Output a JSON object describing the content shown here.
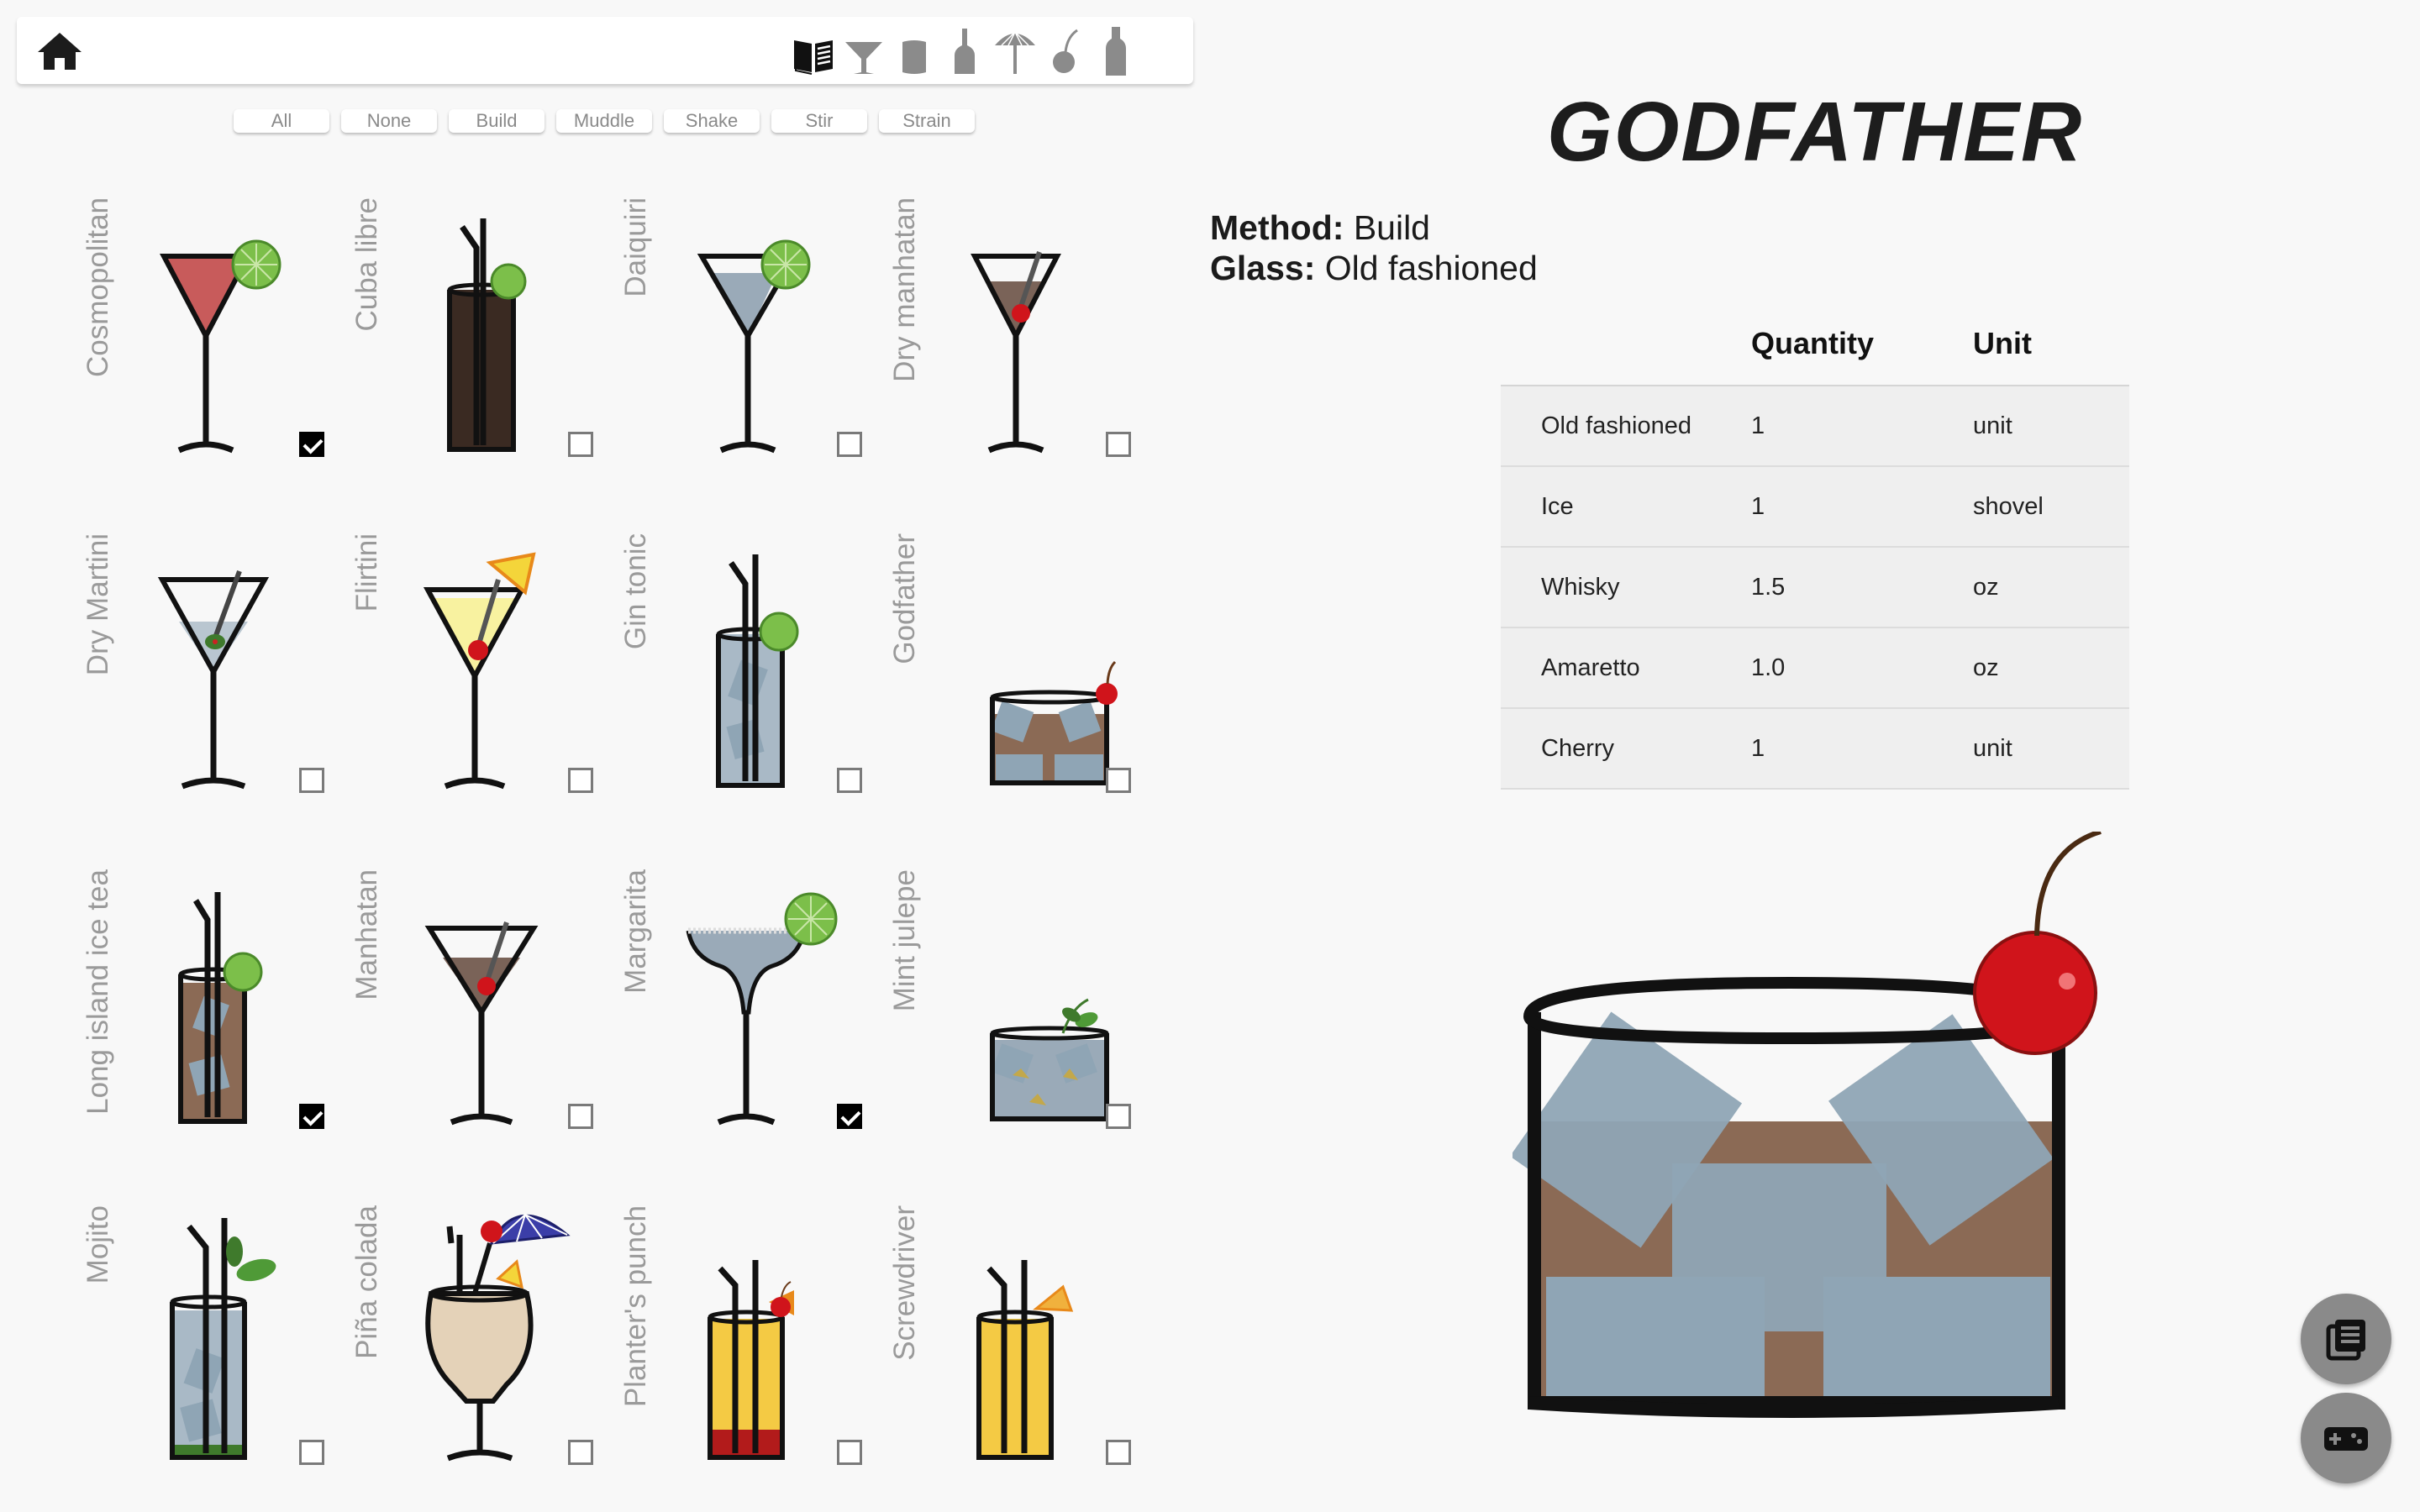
{
  "toolbar": {
    "home_icon": "home-icon",
    "category_icons": [
      "recipe-book-icon",
      "cocktail-glass-icon",
      "tumbler-glass-icon",
      "bottle-small-icon",
      "umbrella-icon",
      "cherry-icon",
      "bottle-icon"
    ]
  },
  "filters": [
    "All",
    "None",
    "Build",
    "Muddle",
    "Shake",
    "Stir",
    "Strain"
  ],
  "cocktails": [
    {
      "name": "Cosmopolitan",
      "checked": true
    },
    {
      "name": "Cuba libre",
      "checked": false
    },
    {
      "name": "Daiquiri",
      "checked": false
    },
    {
      "name": "Dry manhatan",
      "checked": false
    },
    {
      "name": "Dry Martini",
      "checked": false
    },
    {
      "name": "Flirtini",
      "checked": false
    },
    {
      "name": "Gin tonic",
      "checked": false
    },
    {
      "name": "Godfather",
      "checked": false
    },
    {
      "name": "Long island ice tea",
      "checked": true
    },
    {
      "name": "Manhatan",
      "checked": false
    },
    {
      "name": "Margarita",
      "checked": true
    },
    {
      "name": "Mint julepe",
      "checked": false
    },
    {
      "name": "Mojito",
      "checked": false
    },
    {
      "name": "Piña colada",
      "checked": false
    },
    {
      "name": "Planter's punch",
      "checked": false
    },
    {
      "name": "Screwdriver",
      "checked": false
    }
  ],
  "detail": {
    "title": "GODFATHER",
    "method_label": "Method:",
    "method_value": "Build",
    "glass_label": "Glass:",
    "glass_value": "Old fashioned",
    "columns": [
      "",
      "Quantity",
      "Unit"
    ],
    "ingredients": [
      {
        "name": "Old fashioned",
        "quantity": "1",
        "unit": "unit"
      },
      {
        "name": "Ice",
        "quantity": "1",
        "unit": "shovel"
      },
      {
        "name": "Whisky",
        "quantity": "1.5",
        "unit": "oz"
      },
      {
        "name": "Amaretto",
        "quantity": "1.0",
        "unit": "oz"
      },
      {
        "name": "Cherry",
        "quantity": "1",
        "unit": "unit"
      }
    ]
  },
  "fabs": [
    "list-icon",
    "gamepad-icon"
  ],
  "colors": {
    "lime": "#7cbf4a",
    "cherry": "#d0141b",
    "brown_drink": "#8b6a55",
    "ice": "#8fa5b5",
    "yellow_drink": "#f4ca44",
    "pink_drink": "#c85b5b",
    "fab": "#8a8a8a"
  }
}
